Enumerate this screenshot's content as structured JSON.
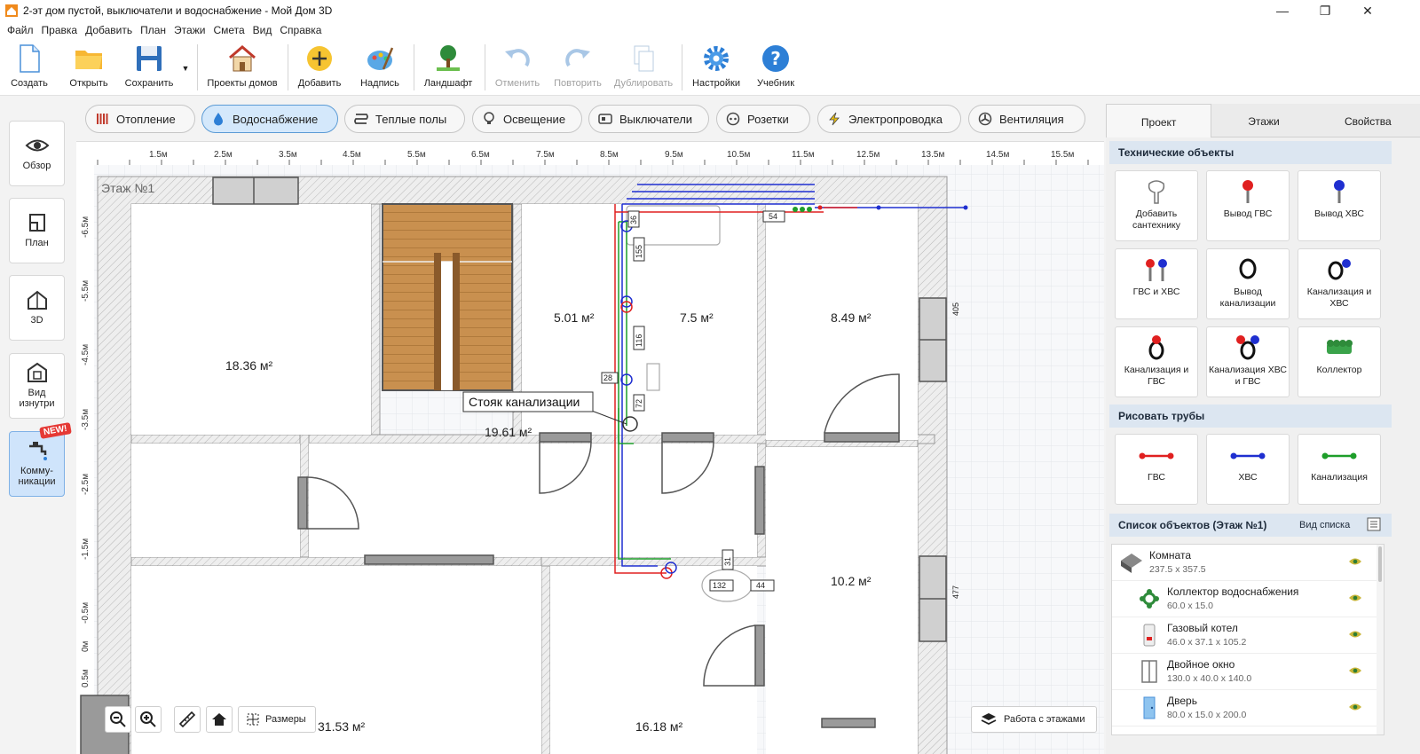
{
  "window": {
    "title": "2-эт дом пустой, выключатели и водоснабжение - Мой Дом 3D",
    "minimize": "—",
    "maximize": "❐",
    "close": "✕"
  },
  "menu": [
    "Файл",
    "Правка",
    "Добавить",
    "План",
    "Этажи",
    "Смета",
    "Вид",
    "Справка"
  ],
  "toolbar": {
    "create": "Создать",
    "open": "Открыть",
    "save": "Сохранить",
    "projects": "Проекты домов",
    "add": "Добавить",
    "label": "Надпись",
    "landscape": "Ландшафт",
    "undo": "Отменить",
    "redo": "Повторить",
    "duplicate": "Дублировать",
    "settings": "Настройки",
    "tutorial": "Учебник"
  },
  "sidebar": {
    "overview": "Обзор",
    "plan": "План",
    "view3d": "3D",
    "inside": "Вид изнутри",
    "comms": "Комму- никации",
    "new_badge": "NEW!"
  },
  "categories": [
    "Отопление",
    "Водоснабжение",
    "Теплые полы",
    "Освещение",
    "Выключатели",
    "Розетки",
    "Электропроводка",
    "Вентиляция"
  ],
  "ruler_top": [
    "1.5м",
    "2.5м",
    "3.5м",
    "4.5м",
    "5.5м",
    "6.5м",
    "7.5м",
    "8.5м",
    "9.5м",
    "10.5м",
    "11.5м",
    "12.5м",
    "13.5м",
    "14.5м",
    "15.5м"
  ],
  "ruler_left": [
    "-6.5м",
    "-5.5м",
    "-4.5м",
    "-3.5м",
    "-2.5м",
    "-1.5м",
    "-0.5м",
    "0м",
    "0.5м"
  ],
  "plan": {
    "floor_label": "Этаж №1",
    "rooms": [
      "18.36 м²",
      "5.01 м²",
      "7.5 м²",
      "8.49 м²",
      "19.61 м²",
      "10.2 м²",
      "31.53 м²",
      "16.18 м²"
    ],
    "tooltip": "Стояк канализации",
    "dims": [
      "36",
      "155",
      "116",
      "28",
      "72",
      "54",
      "31",
      "132",
      "44",
      "405",
      "477"
    ]
  },
  "bottom": {
    "sizes": "Размеры",
    "floors": "Работа с этажами"
  },
  "rpanel": {
    "tabs": [
      "Проект",
      "Этажи",
      "Свойства"
    ],
    "tech_header": "Технические объекты",
    "tiles": [
      "Добавить сантехнику",
      "Вывод ГВС",
      "Вывод ХВС",
      "ГВС и ХВС",
      "Вывод канализации",
      "Канализация и ХВС",
      "Канализация и ГВС",
      "Канализация ХВС и ГВС",
      "Коллектор"
    ],
    "pipes_header": "Рисовать трубы",
    "pipes": [
      "ГВС",
      "ХВС",
      "Канализация"
    ],
    "list_header": "Список объектов (Этаж №1)",
    "list_view": "Вид списка",
    "list": [
      {
        "name": "Комната",
        "dims": "237.5 x 357.5"
      },
      {
        "name": "Коллектор водоснабжения",
        "dims": "60.0 x 15.0"
      },
      {
        "name": "Газовый котел",
        "dims": "46.0 x 37.1 x 105.2"
      },
      {
        "name": "Двойное окно",
        "dims": "130.0 x 40.0 x 140.0"
      },
      {
        "name": "Дверь",
        "dims": "80.0 x 15.0 x 200.0"
      }
    ]
  },
  "colors": {
    "hot": "#e02020",
    "cold": "#1f2fd0",
    "sewer": "#1e9e2a",
    "accent": "#5b9bd5"
  }
}
